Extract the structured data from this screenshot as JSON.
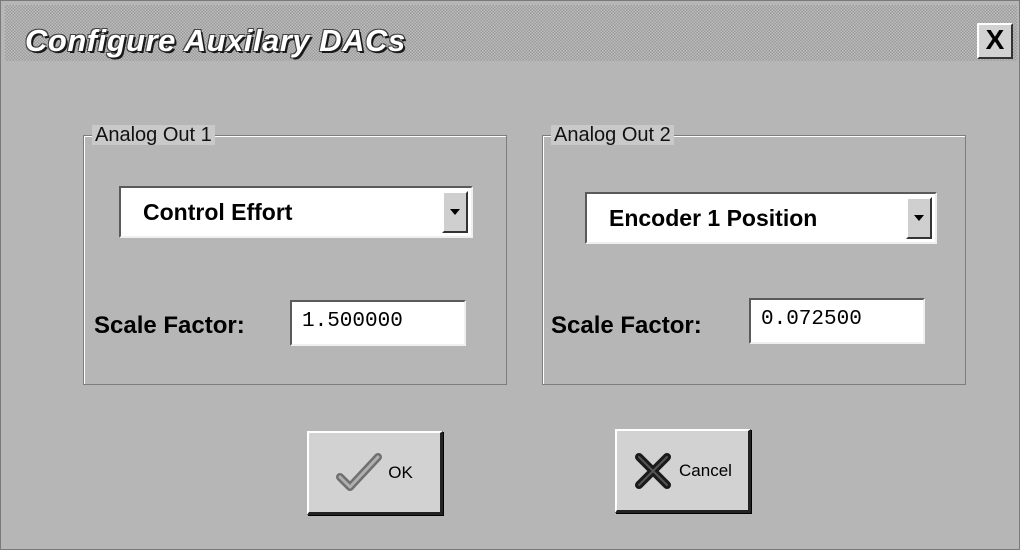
{
  "window": {
    "title": "Configure Auxilary DACs",
    "close_label": "X"
  },
  "analog_out_1": {
    "label": "Analog Out 1",
    "selection": "Control Effort",
    "scale_label": "Scale Factor:",
    "scale_value": "1.500000"
  },
  "analog_out_2": {
    "label": "Analog Out 2",
    "selection": "Encoder 1 Position",
    "scale_label": "Scale Factor:",
    "scale_value": "0.072500"
  },
  "buttons": {
    "ok_label": "OK",
    "ok_icon": "checkmark-icon",
    "cancel_label": "Cancel",
    "cancel_icon": "x-mark-icon"
  },
  "colors": {
    "background": "#c6c6c6",
    "field_bg": "#ffffff",
    "text": "#000000"
  }
}
